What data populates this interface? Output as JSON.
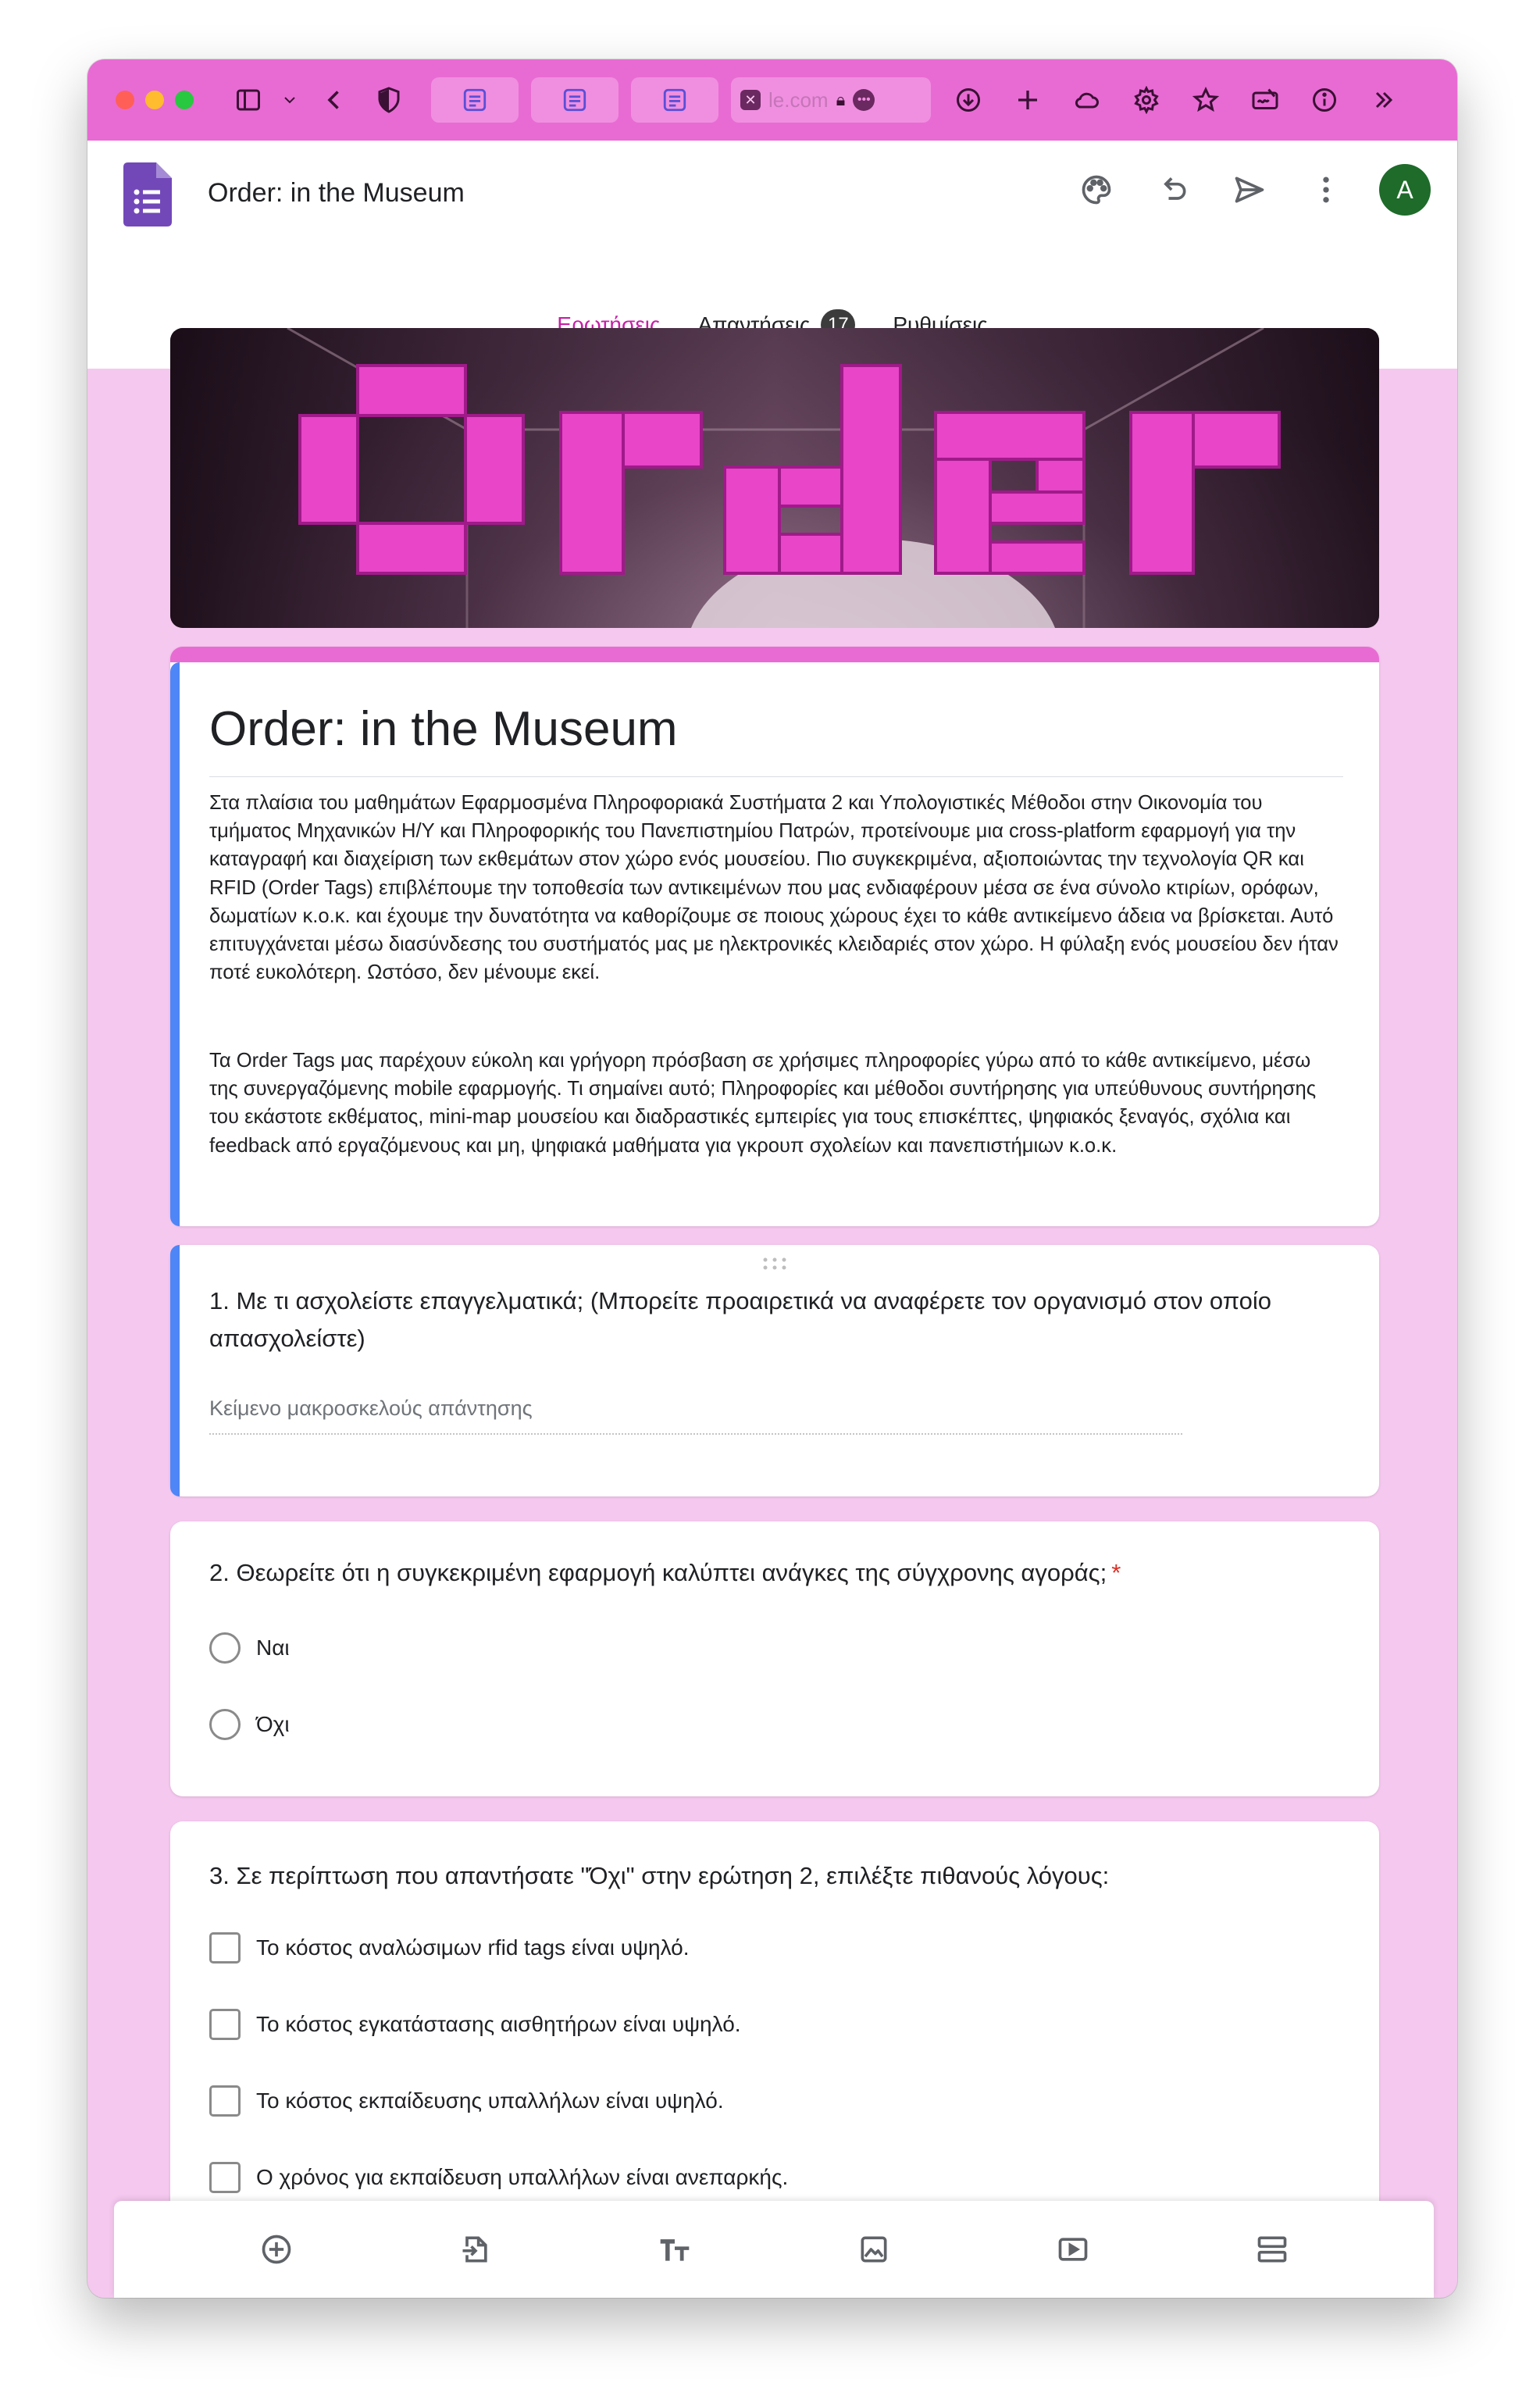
{
  "browser": {
    "url": {
      "faded": "le.com",
      "rest": ""
    },
    "colors": {
      "chrome": "#e86bd3",
      "pill": "#f08fe0",
      "light_red": "#ff5f57",
      "light_yellow": "#febc2e",
      "light_green": "#28c840"
    }
  },
  "form": {
    "title": "Order: in the Museum",
    "tabs": [
      {
        "label": "Ερωτήσεις"
      },
      {
        "label": "Απαντήσεις",
        "badge": "17"
      },
      {
        "label": "Ρυθμίσεις"
      }
    ],
    "avatar": "A",
    "accent": "#c71fa7"
  },
  "banner": {
    "text": "Order"
  },
  "header_card": {
    "title": "Order: in the Museum",
    "paragraph1": "Στα πλαίσια του μαθημάτων Εφαρμοσμένα Πληροφοριακά Συστήματα 2 και Υπολογιστικές Μέθοδοι στην Οικονομία του τμήματος Μηχανικών Η/Υ και Πληροφορικής του Πανεπιστημίου Πατρών, προτείνουμε μια cross-platform εφαρμογή για την καταγραφή και διαχείριση των εκθεμάτων στον χώρο ενός μουσείου. Πιο συγκεκριμένα, αξιοποιώντας την τεχνολογία QR και RFID (Order Tags) επιβλέπουμε την τοποθεσία των αντικειμένων που μας ενδιαφέρουν μέσα σε ένα σύνολο κτιρίων, ορόφων, δωματίων κ.ο.κ. και έχουμε την δυνατότητα να καθορίζουμε σε ποιους χώρους έχει το κάθε αντικείμενο άδεια να βρίσκεται. Αυτό επιτυγχάνεται μέσω διασύνδεσης του συστήματός μας με ηλεκτρονικές κλειδαριές στον χώρο. Η φύλαξη ενός μουσείου δεν ήταν ποτέ ευκολότερη. Ωστόσο, δεν μένουμε εκεί.",
    "paragraph2": "Τα Order Tags μας παρέχουν εύκολη και γρήγορη πρόσβαση σε χρήσιμες πληροφορίες γύρω από το κάθε αντικείμενο, μέσω της συνεργαζόμενης mobile εφαρμογής. Τι σημαίνει αυτό; Πληροφορίες και μέθοδοι συντήρησης για υπεύθυνους συντήρησης του εκάστοτε εκθέματος, mini-map μουσείου και διαδραστικές εμπειρίες για τους επισκέπτες, ψηφιακός ξεναγός, σχόλια και feedback από εργαζόμενους και μη, ψηφιακά μαθήματα για γκρουπ σχολείων και πανεπιστήμιων κ.ο.κ."
  },
  "questions": [
    {
      "title": "1. Με τι ασχολείστε επαγγελματικά; (Μπορείτε προαιρετικά να αναφέρετε τον οργανισμό στον οποίο απασχολείστε)",
      "placeholder": "Κείμενο μακροσκελούς απάντησης"
    },
    {
      "title": "2. Θεωρείτε ότι η συγκεκριμένη εφαρμογή καλύπτει ανάγκες της σύγχρονης αγοράς;",
      "required": "*",
      "options": [
        "Ναι",
        "Όχι"
      ]
    },
    {
      "title": "3. Σε περίπτωση που απαντήσατε \"Όχι\" στην ερώτηση 2, επιλέξτε πιθανούς λόγους:",
      "options": [
        "Το κόστος αναλώσιμων rfid tags είναι υψηλό.",
        "Το κόστος εγκατάστασης αισθητήρων είναι υψηλό.",
        "Το κόστος εκπαίδευσης υπαλλήλων είναι υψηλό.",
        "Ο χρόνος για εκπαίδευση υπαλλήλων είναι ανεπαρκής."
      ]
    }
  ]
}
